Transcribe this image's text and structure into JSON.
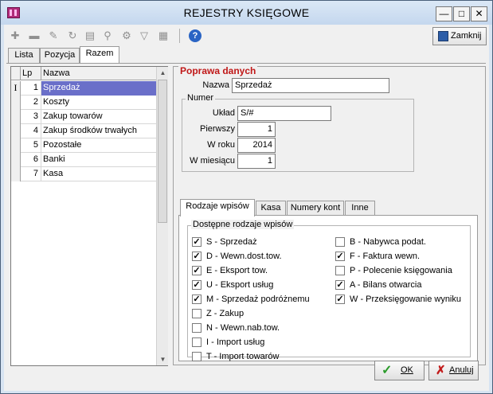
{
  "window": {
    "title": "REJESTRY KSIĘGOWE",
    "controls": {
      "minimize": "—",
      "maximize": "□",
      "close": "✕"
    }
  },
  "toolbar": {
    "icons": [
      "add-icon",
      "delete-icon",
      "edit-icon",
      "refresh-icon",
      "print-icon",
      "find-icon",
      "tools-icon",
      "filter-icon",
      "list-icon",
      "help-icon"
    ],
    "help_glyph": "?",
    "close_label": "Zamknij"
  },
  "tabs": [
    "Lista",
    "Pozycja",
    "Razem"
  ],
  "active_tab": "Razem",
  "grid": {
    "columns": [
      "Lp",
      "Nazwa"
    ],
    "indicator": "I",
    "rows": [
      {
        "lp": "1",
        "name": "Sprzedaż",
        "selected": true
      },
      {
        "lp": "2",
        "name": "Koszty"
      },
      {
        "lp": "3",
        "name": "Zakup towarów"
      },
      {
        "lp": "4",
        "name": "Zakup środków trwałych"
      },
      {
        "lp": "5",
        "name": "Pozostałe"
      },
      {
        "lp": "6",
        "name": "Banki"
      },
      {
        "lp": "7",
        "name": "Kasa"
      }
    ]
  },
  "form": {
    "section_title": "Poprawa danych",
    "name_label": "Nazwa",
    "name_value": "Sprzedaż",
    "numer_title": "Numer",
    "uklad_label": "Układ",
    "uklad_value": "S/#",
    "pierwszy_label": "Pierwszy",
    "pierwszy_value": "1",
    "wroku_label": "W roku",
    "wroku_value": "2014",
    "wmiesiacu_label": "W miesiącu",
    "wmiesiacu_value": "1"
  },
  "inner_tabs": [
    "Rodzaje wpisów",
    "Kasa",
    "Numery kont",
    "Inne"
  ],
  "entry_types": {
    "title": "Dostępne rodzaje wpisów",
    "left": [
      {
        "label": "S - Sprzedaż",
        "checked": true
      },
      {
        "label": "D - Wewn.dost.tow.",
        "checked": true
      },
      {
        "label": "E - Eksport tow.",
        "checked": true
      },
      {
        "label": "U - Eksport usług",
        "checked": true
      },
      {
        "label": "M - Sprzedaż podróżnemu",
        "checked": true
      },
      {
        "label": "Z - Zakup",
        "checked": false
      },
      {
        "label": "N - Wewn.nab.tow.",
        "checked": false
      },
      {
        "label": "I - Import usług",
        "checked": false
      },
      {
        "label": "T - Import towarów",
        "checked": false
      }
    ],
    "right": [
      {
        "label": "B - Nabywca podat.",
        "checked": false
      },
      {
        "label": "F - Faktura wewn.",
        "checked": true
      },
      {
        "label": "P - Polecenie księgowania",
        "checked": false
      },
      {
        "label": "A - Bilans otwarcia",
        "checked": true
      },
      {
        "label": "W - Przeksięgowanie wyniku",
        "checked": true
      }
    ],
    "check_glyph": "✓"
  },
  "buttons": {
    "ok": "OK",
    "cancel": "Anuluj",
    "ok_glyph": "✓",
    "cancel_glyph": "✗"
  },
  "scroll": {
    "up": "▲",
    "down": "▼"
  }
}
